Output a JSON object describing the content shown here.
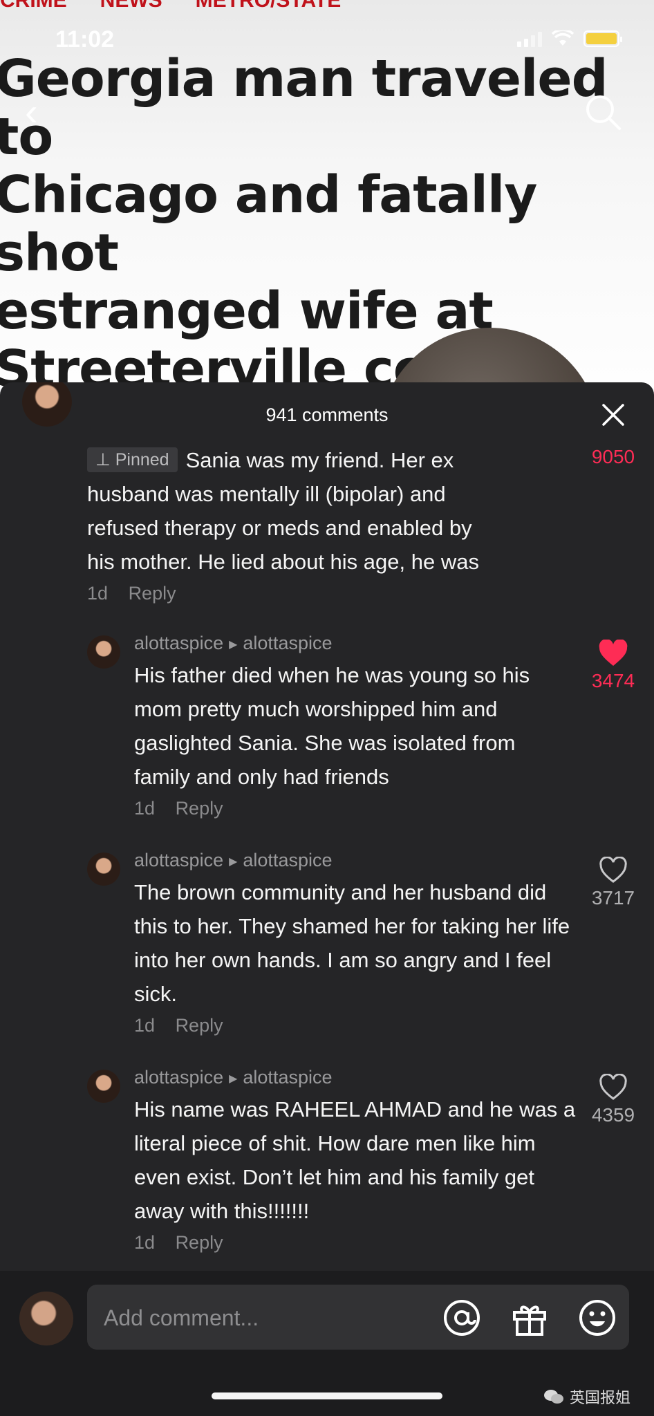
{
  "status_bar": {
    "time": "11:02"
  },
  "article": {
    "tags": [
      "CRIME",
      "NEWS",
      "METRO/STATE"
    ],
    "headline": "Georgia man traveled to\nChicago and fatally shot\nestranged wife at\nStreeterville condo, then\nkilled himself as cops\narrived: police"
  },
  "sheet": {
    "title": "941 comments",
    "comments": [
      {
        "pinned_label": "Pinned",
        "text": "Sania was my friend. Her ex husband was mentally ill (bipolar) and refused therapy or meds and enabled by his mother. He lied about his age, he was",
        "time": "1d",
        "reply": "Reply",
        "likes": "9050"
      },
      {
        "user": "alottaspice",
        "reply_to": "alottaspice",
        "text": "His father died when he was young so his mom pretty much worshipped him and gaslighted Sania. She was isolated from family and only had friends",
        "time": "1d",
        "reply": "Reply",
        "likes": "3474",
        "liked": true
      },
      {
        "user": "alottaspice",
        "reply_to": "alottaspice",
        "text": "The brown community and her husband did this to her. They shamed her for taking her life into her own hands. I am so angry and I feel sick.",
        "time": "1d",
        "reply": "Reply",
        "likes": "3717",
        "liked": false
      },
      {
        "user": "alottaspice",
        "reply_to": "alottaspice",
        "text": "His name was RAHEEL AHMAD and he was a literal piece of shit. How dare men like him even exist. Don’t let him and his family get away with this!!!!!!!",
        "time": "1d",
        "reply": "Reply",
        "likes": "4359",
        "liked": false
      }
    ]
  },
  "composer": {
    "placeholder": "Add comment..."
  },
  "watermark": "英国报姐",
  "colors": {
    "sheet_bg": "#252527",
    "like_red": "#fe2c55",
    "headline_red": "#c0121b"
  }
}
